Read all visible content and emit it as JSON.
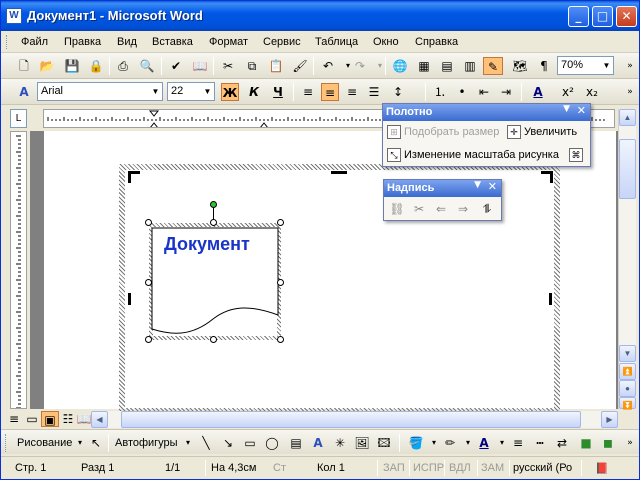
{
  "window": {
    "title": "Документ1 - Microsoft Word",
    "app_icon_letter": "W",
    "minimize_glyph": "_",
    "maximize_glyph": "□",
    "close_glyph": "✕"
  },
  "menu": {
    "items": [
      "Файл",
      "Правка",
      "Вид",
      "Вставка",
      "Формат",
      "Сервис",
      "Таблица",
      "Окно",
      "Справка"
    ]
  },
  "standard_toolbar": {
    "zoom": "70%",
    "icons": [
      "new-icon",
      "open-icon",
      "save-icon",
      "permission-icon",
      "print-icon",
      "print-preview-icon",
      "spelling-icon",
      "research-icon",
      "cut-icon",
      "copy-icon",
      "paste-icon",
      "format-painter-icon",
      "undo-icon",
      "redo-icon",
      "hyperlink-icon",
      "tables-borders-icon",
      "insert-table-icon",
      "insert-excel-icon",
      "drawing-icon",
      "document-map-icon",
      "show-hide-icon"
    ]
  },
  "formatting_toolbar": {
    "font": "Arial",
    "size": "22",
    "bold": "Ж",
    "italic": "К",
    "underline": "Ч"
  },
  "canvas_toolbar": {
    "title": "Полотно",
    "fit_label": "Подобрать размер",
    "expand_label": "Увеличить",
    "scale_label": "Изменение масштаба рисунка"
  },
  "textbox_toolbar": {
    "title": "Надпись"
  },
  "document": {
    "textbox_text": "Документ"
  },
  "drawing_toolbar": {
    "draw_label": "Рисование",
    "autoshapes_label": "Автофигуры"
  },
  "status": {
    "page": "Стр. 1",
    "section": "Разд 1",
    "pages": "1/1",
    "at": "На 4,3см",
    "line": "Ст",
    "col": "Кол 1",
    "rec": "ЗАП",
    "trk": "ИСПР",
    "ext": "ВДЛ",
    "ovr": "ЗАМ",
    "language": "русский (Ро"
  },
  "colors": {
    "accent": "#0058e6",
    "textbox_text": "#1a34c8",
    "active_button": "#ffc078"
  }
}
